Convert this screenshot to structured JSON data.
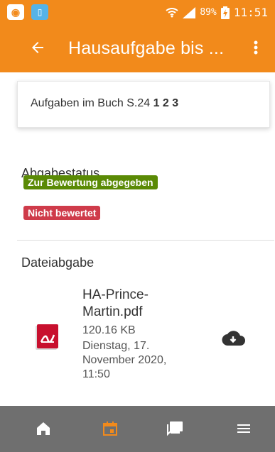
{
  "status_bar": {
    "battery_percent": "89%",
    "time": "11:51",
    "icons": [
      "app-icon",
      "phone-icon",
      "wifi-icon",
      "signal-icon",
      "battery-icon"
    ]
  },
  "app_bar": {
    "title": "Hausaufgabe bis ...",
    "icons": {
      "back": "back-arrow-icon",
      "more": "more-vert-icon"
    }
  },
  "task": {
    "text": "Aufgaben im Buch S.24",
    "numbers": "1 2 3"
  },
  "submission_status": {
    "title": "Abgabestatus",
    "status_badge": "Zur Bewertung abgegeben",
    "grading_badge": "Nicht bewertet",
    "colors": {
      "status_badge": "#5a8a05",
      "grading_badge": "#cf3b4a",
      "accent": "#f28a1b",
      "bottom_bar": "#6f6f6f"
    }
  },
  "file_submission": {
    "title": "Dateiabgabe",
    "file_name_line1": "HA-Prince-",
    "file_name_line2": "Martin.pdf",
    "file_size": "120.16 KB",
    "date_line1": "Dienstag, 17.",
    "date_line2": "November 2020,",
    "date_line3": "11:50",
    "icons": {
      "file": "pdf-file-icon",
      "download": "cloud-download-icon"
    }
  },
  "bottom_nav": {
    "tabs": [
      {
        "icon": "home-icon",
        "active": false
      },
      {
        "icon": "calendar-icon",
        "active": true
      },
      {
        "icon": "messages-icon",
        "active": false
      },
      {
        "icon": "menu-icon",
        "active": false
      }
    ]
  }
}
